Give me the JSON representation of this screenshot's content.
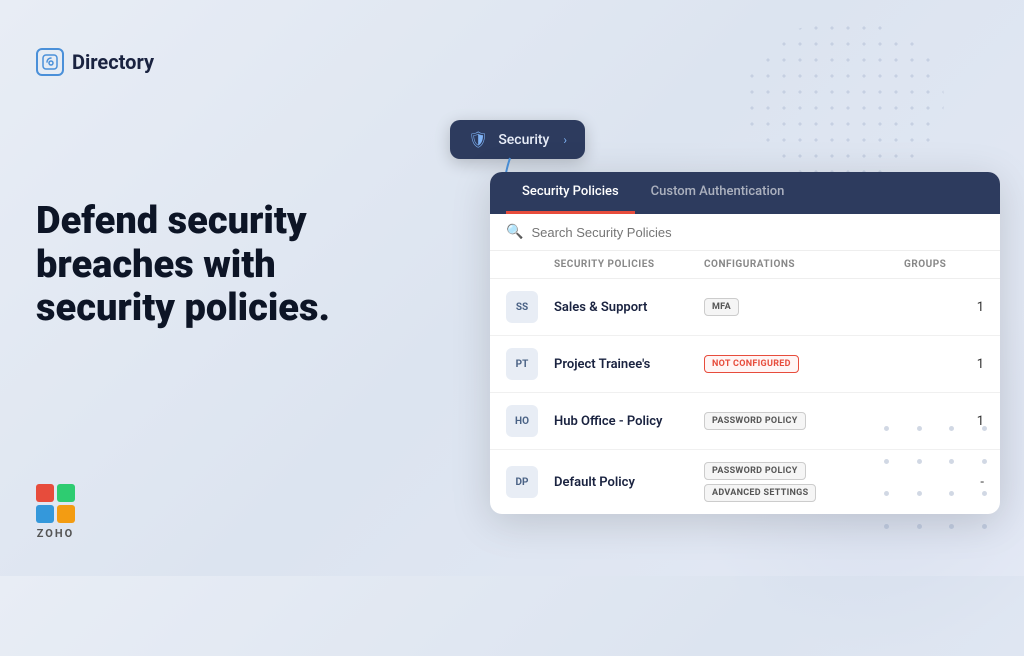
{
  "logo": {
    "icon": "🔐",
    "text": "Directory"
  },
  "headline": {
    "line1": "Defend security",
    "line2": "breaches with",
    "line3": "security policies."
  },
  "security_pill": {
    "label": "Security",
    "icon": "🛡"
  },
  "panel": {
    "tabs": [
      {
        "label": "Security Policies",
        "active": true
      },
      {
        "label": "Custom Authentication",
        "active": false
      }
    ],
    "search": {
      "placeholder": "Search Security Policies"
    },
    "table": {
      "headers": [
        "",
        "SECURITY POLICIES",
        "CONFIGURATIONS",
        "GROUPS"
      ],
      "rows": [
        {
          "avatar": "SS",
          "name": "Sales & Support",
          "tags": [
            {
              "text": "MFA",
              "type": "mfa"
            }
          ],
          "groups": "1"
        },
        {
          "avatar": "PT",
          "name": "Project Trainee's",
          "tags": [
            {
              "text": "NOT CONFIGURED",
              "type": "not-configured"
            }
          ],
          "groups": "1"
        },
        {
          "avatar": "HO",
          "name": "Hub Office - Policy",
          "tags": [
            {
              "text": "PASSWORD POLICY",
              "type": "password"
            }
          ],
          "groups": "1"
        },
        {
          "avatar": "DP",
          "name": "Default Policy",
          "tags": [
            {
              "text": "PASSWORD POLICY",
              "type": "password"
            },
            {
              "text": "ADVANCED SETTINGS",
              "type": "advanced"
            }
          ],
          "groups": "-"
        }
      ]
    }
  },
  "zoho": {
    "text": "ZOHO",
    "colors": [
      "#e74c3c",
      "#2ecc71",
      "#3498db",
      "#f39c12"
    ]
  }
}
